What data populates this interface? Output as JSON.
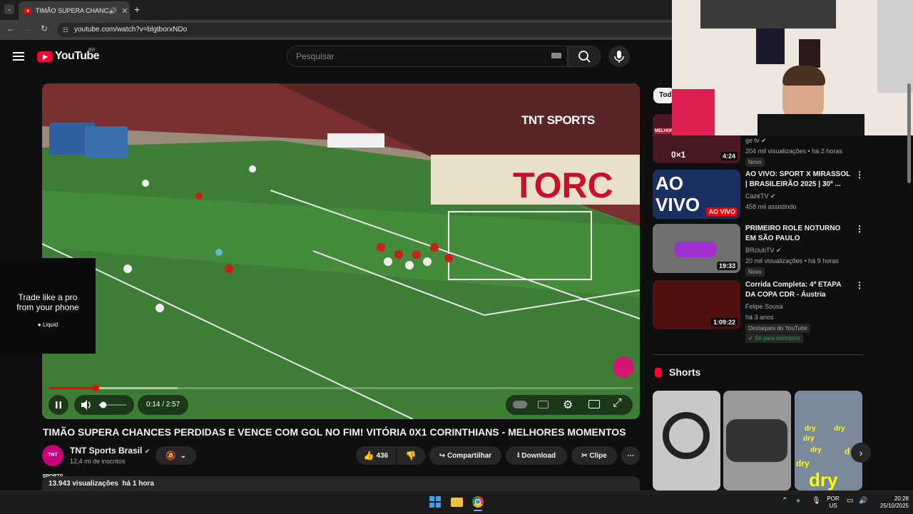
{
  "browser": {
    "tab_title": "TIMÃO SUPERA CHANCES PERDIDAS",
    "url": "youtube.com/watch?v=blgtborxNDo"
  },
  "header": {
    "logo_text": "YouTube",
    "country_code": "BR",
    "search_placeholder": "Pesquisar"
  },
  "player": {
    "ad_line1": "Trade like a pro",
    "ad_line2": "from your phone",
    "ad_brand": "Liquid",
    "broadcaster_watermark": "TNT SPORTS",
    "time": "0:14 / 2:57",
    "progress_fraction": 0.08,
    "buffer_fraction": 0.22,
    "volume_fraction": 0.15
  },
  "video": {
    "title": "TIMÃO SUPERA CHANCES PERDIDAS E VENCE COM GOL NO FIM! VITÓRIA 0X1 CORINTHIANS - MELHORES MOMENTOS",
    "channel": "TNT Sports Brasil",
    "channel_avatar_text": "TNT SPORTS",
    "subscribers": "12,4 mi de inscritos",
    "likes": "436",
    "share_label": "Compartilhar",
    "download_label": "Download",
    "clip_label": "Clipe",
    "views": "13.943 visualizações",
    "posted": "há 1 hora"
  },
  "sidebar": {
    "chip": "Tod",
    "items": [
      {
        "channel": "ge tv",
        "meta": "204 mil visualizações • há 2 horas",
        "badge": "Novo",
        "duration": "4:24",
        "thumb_text": "0×1",
        "thumb_label": "MELHORES MOMENTOS"
      },
      {
        "title": "AO VIVO: SPORT X MIRASSOL | BRASILEIRÃO 2025 | 30ª ...",
        "channel": "CazéTV",
        "meta": "458 mil assistindo",
        "thumb_text": "AO VIVO",
        "live_label": "AO VIVO"
      },
      {
        "title": "PRIMEIRO ROLE NOTURNO EM SÃO PAULO",
        "channel": "BRclubTV",
        "meta": "20 mil visualizações • há 9 horas",
        "badge": "Novo",
        "duration": "19:33"
      },
      {
        "title": "Corrida Completa: 4ª ETAPA DA COPA CDR - Áustria",
        "channel": "Felipe Sousa",
        "meta": "há 3 anos",
        "badge": "Destaques do YouTube",
        "members": "Só para membros",
        "duration": "1:09:22"
      }
    ],
    "shorts_heading": "Shorts",
    "shorts_text": [
      "dry",
      "dry",
      "dry",
      "dry",
      "dry",
      "dry",
      "d"
    ]
  },
  "taskbar": {
    "lang1": "POR",
    "lang2": "US",
    "time": "20:28",
    "date": "25/10/2025"
  }
}
